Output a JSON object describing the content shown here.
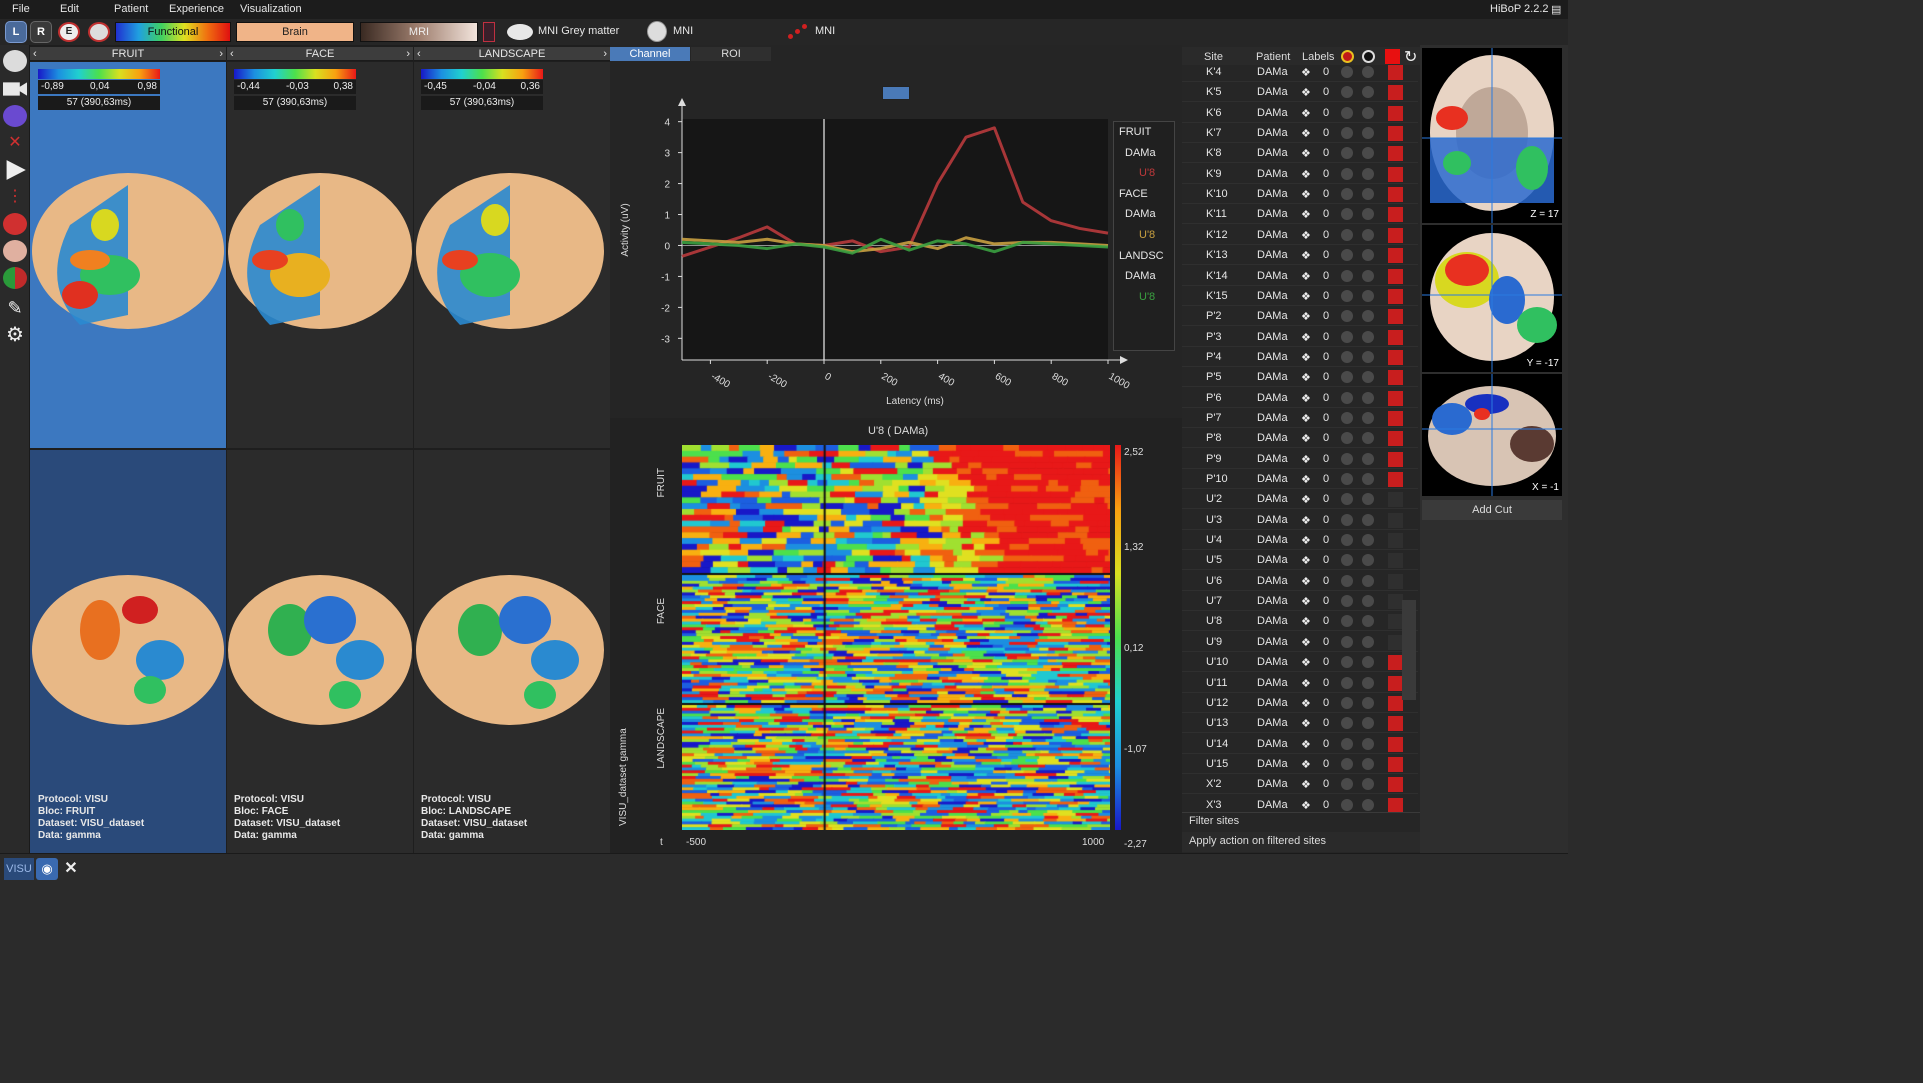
{
  "menu": [
    "File",
    "Edit",
    "Patient",
    "Experience",
    "Visualization"
  ],
  "app_version": "HiBoP 2.2.2",
  "toolbar": {
    "view_left": "L",
    "view_right": "R",
    "view_e": "E",
    "colormap_functional": "Functional",
    "colormap_brain": "Brain",
    "colormap_mri": "MRI",
    "mesh_label": "MNI Grey matter",
    "mri_label": "MNI",
    "sites_label": "MNI"
  },
  "columns": [
    {
      "title": "FRUIT",
      "cb": {
        "min": "-0,89",
        "mid": "0,04",
        "max": "0,98"
      },
      "time": "57 (390,63ms)",
      "info": {
        "protocol": "Protocol: VISU",
        "bloc": "Bloc: FRUIT",
        "dataset": "Dataset: VISU_dataset",
        "data": "Data: gamma"
      }
    },
    {
      "title": "FACE",
      "cb": {
        "min": "-0,44",
        "mid": "-0,03",
        "max": "0,38"
      },
      "time": "57 (390,63ms)",
      "info": {
        "protocol": "Protocol: VISU",
        "bloc": "Bloc: FACE",
        "dataset": "Dataset: VISU_dataset",
        "data": "Data: gamma"
      }
    },
    {
      "title": "LANDSCAPE",
      "cb": {
        "min": "-0,45",
        "mid": "-0,04",
        "max": "0,36"
      },
      "time": "57 (390,63ms)",
      "info": {
        "protocol": "Protocol: VISU",
        "bloc": "Bloc: LANDSCAPE",
        "dataset": "Dataset: VISU_dataset",
        "data": "Data: gamma"
      }
    }
  ],
  "tabs": {
    "channel": "Channel",
    "roi": "ROI"
  },
  "graph": {
    "ylabel": "Activity (uV)",
    "xlabel": "Latency (ms)",
    "yticks": [
      "4",
      "3",
      "2",
      "1",
      "0",
      "-1",
      "-2",
      "-3"
    ],
    "xticks": [
      "-400",
      "-200",
      "0",
      "200",
      "400",
      "600",
      "800",
      "1000"
    ],
    "legend": [
      {
        "text": "FRUIT",
        "color": "#e6e6e6"
      },
      {
        "text": "DAMa",
        "color": "#e6e6e6"
      },
      {
        "text": "U'8",
        "color": "#c0393b"
      },
      {
        "text": "FACE",
        "color": "#e6e6e6"
      },
      {
        "text": "DAMa",
        "color": "#e6e6e6"
      },
      {
        "text": "U'8",
        "color": "#c8a040"
      },
      {
        "text": "LANDSC",
        "color": "#e6e6e6"
      },
      {
        "text": "DAMa",
        "color": "#e6e6e6"
      },
      {
        "text": "U'8",
        "color": "#3aa040"
      }
    ]
  },
  "chart_data": [
    {
      "type": "line",
      "title": "",
      "xlabel": "Latency (ms)",
      "ylabel": "Activity (uV)",
      "xlim": [
        -500,
        1000
      ],
      "ylim": [
        -3.7,
        4.7
      ],
      "x": [
        -500,
        -400,
        -300,
        -200,
        -100,
        0,
        100,
        200,
        300,
        400,
        500,
        600,
        700,
        800,
        900,
        1000
      ],
      "series": [
        {
          "name": "FRUIT DAMa U'8",
          "color": "#b83a3c",
          "values": [
            -0.35,
            -0.05,
            0.25,
            0.6,
            0.05,
            0.0,
            0.15,
            -0.2,
            -0.05,
            2.0,
            3.5,
            3.8,
            1.4,
            0.8,
            0.55,
            0.4
          ]
        },
        {
          "name": "FACE DAMa U'8",
          "color": "#c8a040",
          "values": [
            0.2,
            0.15,
            0.1,
            0.2,
            0.05,
            0.0,
            -0.2,
            -0.1,
            0.1,
            -0.1,
            0.25,
            0.05,
            0.1,
            0.1,
            0.05,
            0.0
          ]
        },
        {
          "name": "LANDSC DAMa U'8",
          "color": "#3aa040",
          "values": [
            0.1,
            0.05,
            0.0,
            -0.1,
            0.05,
            -0.05,
            -0.25,
            0.2,
            -0.15,
            0.15,
            0.05,
            -0.2,
            0.1,
            0.05,
            0.0,
            -0.05
          ]
        }
      ]
    },
    {
      "type": "heatmap",
      "title": "U'8 ( DAMa)",
      "xlim": [
        -500,
        1000
      ],
      "x_axis_label": "t",
      "xmin_label": "-500",
      "xmax_label": "1000",
      "y_axis_label": "VISU_dataset gamma",
      "row_groups": [
        "FRUIT",
        "FACE",
        "LANDSCAPE"
      ],
      "colorbar": [
        "2,52",
        "1,32",
        "0,12",
        "-1,07",
        "-2,27"
      ]
    }
  ],
  "sites_table": {
    "headers": {
      "site": "Site",
      "patient": "Patient",
      "labels": "Labels"
    },
    "rows": [
      {
        "site": "K'4",
        "patient": "DAMa",
        "labels": "0",
        "roi": true
      },
      {
        "site": "K'5",
        "patient": "DAMa",
        "labels": "0",
        "roi": true
      },
      {
        "site": "K'6",
        "patient": "DAMa",
        "labels": "0",
        "roi": true
      },
      {
        "site": "K'7",
        "patient": "DAMa",
        "labels": "0",
        "roi": true
      },
      {
        "site": "K'8",
        "patient": "DAMa",
        "labels": "0",
        "roi": true
      },
      {
        "site": "K'9",
        "patient": "DAMa",
        "labels": "0",
        "roi": true
      },
      {
        "site": "K'10",
        "patient": "DAMa",
        "labels": "0",
        "roi": true
      },
      {
        "site": "K'11",
        "patient": "DAMa",
        "labels": "0",
        "roi": true
      },
      {
        "site": "K'12",
        "patient": "DAMa",
        "labels": "0",
        "roi": true
      },
      {
        "site": "K'13",
        "patient": "DAMa",
        "labels": "0",
        "roi": true
      },
      {
        "site": "K'14",
        "patient": "DAMa",
        "labels": "0",
        "roi": true
      },
      {
        "site": "K'15",
        "patient": "DAMa",
        "labels": "0",
        "roi": true
      },
      {
        "site": "P'2",
        "patient": "DAMa",
        "labels": "0",
        "roi": true
      },
      {
        "site": "P'3",
        "patient": "DAMa",
        "labels": "0",
        "roi": true
      },
      {
        "site": "P'4",
        "patient": "DAMa",
        "labels": "0",
        "roi": true
      },
      {
        "site": "P'5",
        "patient": "DAMa",
        "labels": "0",
        "roi": true
      },
      {
        "site": "P'6",
        "patient": "DAMa",
        "labels": "0",
        "roi": true
      },
      {
        "site": "P'7",
        "patient": "DAMa",
        "labels": "0",
        "roi": true
      },
      {
        "site": "P'8",
        "patient": "DAMa",
        "labels": "0",
        "roi": true
      },
      {
        "site": "P'9",
        "patient": "DAMa",
        "labels": "0",
        "roi": true
      },
      {
        "site": "P'10",
        "patient": "DAMa",
        "labels": "0",
        "roi": true
      },
      {
        "site": "U'2",
        "patient": "DAMa",
        "labels": "0",
        "roi": false
      },
      {
        "site": "U'3",
        "patient": "DAMa",
        "labels": "0",
        "roi": false
      },
      {
        "site": "U'4",
        "patient": "DAMa",
        "labels": "0",
        "roi": false
      },
      {
        "site": "U'5",
        "patient": "DAMa",
        "labels": "0",
        "roi": false
      },
      {
        "site": "U'6",
        "patient": "DAMa",
        "labels": "0",
        "roi": false
      },
      {
        "site": "U'7",
        "patient": "DAMa",
        "labels": "0",
        "roi": false
      },
      {
        "site": "U'8",
        "patient": "DAMa",
        "labels": "0",
        "roi": false
      },
      {
        "site": "U'9",
        "patient": "DAMa",
        "labels": "0",
        "roi": false
      },
      {
        "site": "U'10",
        "patient": "DAMa",
        "labels": "0",
        "roi": true
      },
      {
        "site": "U'11",
        "patient": "DAMa",
        "labels": "0",
        "roi": true
      },
      {
        "site": "U'12",
        "patient": "DAMa",
        "labels": "0",
        "roi": true
      },
      {
        "site": "U'13",
        "patient": "DAMa",
        "labels": "0",
        "roi": true
      },
      {
        "site": "U'14",
        "patient": "DAMa",
        "labels": "0",
        "roi": true
      },
      {
        "site": "U'15",
        "patient": "DAMa",
        "labels": "0",
        "roi": true
      },
      {
        "site": "X'2",
        "patient": "DAMa",
        "labels": "0",
        "roi": true
      },
      {
        "site": "X'3",
        "patient": "DAMa",
        "labels": "0",
        "roi": true
      }
    ],
    "filter_label": "Filter sites",
    "apply_label": "Apply action on filtered sites"
  },
  "cuts": {
    "labels": [
      "Z = 17",
      "Y = -17",
      "X = -1"
    ],
    "add_cut": "Add Cut"
  },
  "bottom": {
    "visu_tab": "VISU"
  }
}
